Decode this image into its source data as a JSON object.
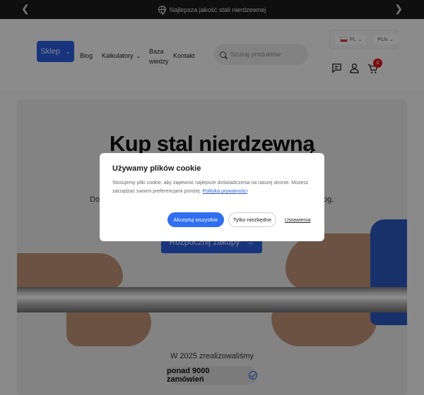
{
  "topbar": {
    "prev_label": "❮",
    "next_label": "❯",
    "message": "Najlepsza jakość stali nierdzewnej"
  },
  "header": {
    "shop_button": "Sklep",
    "nav": {
      "blog": "Blog",
      "calculators": "Kalkulatory",
      "knowledge_line1": "Baza",
      "knowledge_line2": "wiedzy",
      "contact": "Kontakt"
    },
    "search_placeholder": "Szukaj produktów",
    "language": "PL",
    "currency": "PLN",
    "cart_count": "0"
  },
  "hero": {
    "title_line1": "Kup stal nierdzewną",
    "subtitle_left": "Do",
    "subtitle_right": "og.",
    "cta_label": "Rozpocznij zakupy",
    "stat_line": "W 2025 zrealizowaliśmy",
    "stat_pill": "ponad 9000 zamówień"
  },
  "cookie_modal": {
    "title": "Używamy plików cookie",
    "body": "Stosujemy pliki cookie, aby zapewnić najlepsze doświadczenia na naszej stronie. Możesz zarządzać swoimi preferencjami poniżej.",
    "privacy_link": "Polityka prywatności",
    "accept_all": "Akceptuj wszystkie",
    "necessary_only": "Tylko niezbędne",
    "settings": "Ustawienia"
  },
  "colors": {
    "accent": "#2a5bd6",
    "accept_button": "#2f6ff0",
    "badge": "#d4141b",
    "topbar_bg": "#1b1b1b"
  }
}
